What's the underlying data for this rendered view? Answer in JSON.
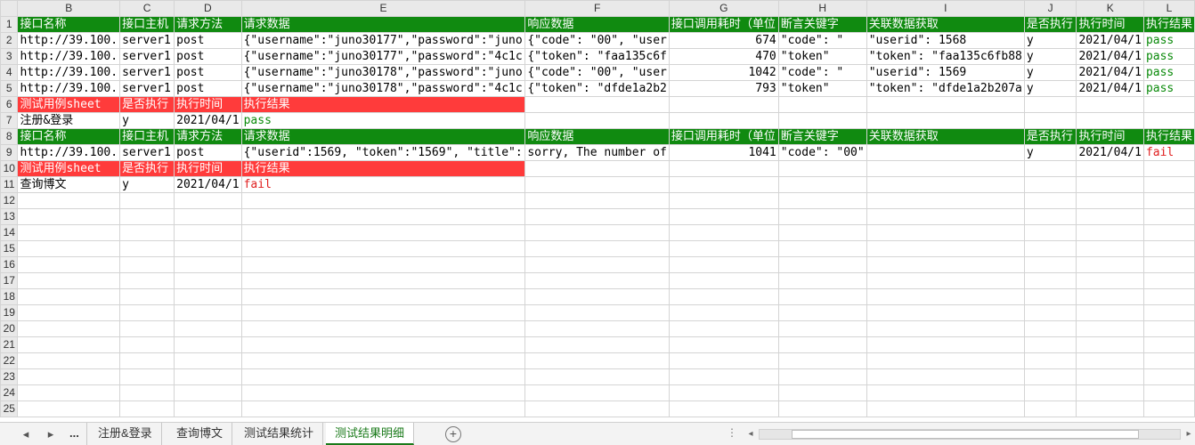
{
  "columns": [
    "B",
    "C",
    "D",
    "E",
    "F",
    "G",
    "H",
    "I",
    "J",
    "K",
    "L"
  ],
  "rows": [
    "1",
    "2",
    "3",
    "4",
    "5",
    "6",
    "7",
    "8",
    "9",
    "10",
    "11",
    "12",
    "13",
    "14",
    "15",
    "16",
    "17",
    "18",
    "19",
    "20",
    "21",
    "22",
    "23",
    "24",
    "25"
  ],
  "header1": [
    "接口名称",
    "接口主机",
    "请求方法",
    "请求数据",
    "响应数据",
    "接口调用耗时（单位",
    "断言关键字",
    "关联数据获取",
    "是否执行",
    "执行时间",
    "执行结果"
  ],
  "data1": [
    [
      "http://39.100.",
      "server1",
      "post",
      "{\"username\":\"juno30177\",\"password\":\"juno",
      "{\"code\": \"00\", \"user",
      "674",
      "\"code\": \"",
      "\"userid\": 1568",
      "y",
      "2021/04/1",
      "pass"
    ],
    [
      "http://39.100.",
      "server1",
      "post",
      "{\"username\":\"juno30177\",\"password\":\"4c1c",
      "{\"token\": \"faa135c6f",
      "470",
      "\"token\"",
      "\"token\": \"faa135c6fb88",
      "y",
      "2021/04/1",
      "pass"
    ],
    [
      "http://39.100.",
      "server1",
      "post",
      "{\"username\":\"juno30178\",\"password\":\"juno",
      "{\"code\": \"00\", \"user",
      "1042",
      "\"code\": \"",
      "\"userid\": 1569",
      "y",
      "2021/04/1",
      "pass"
    ],
    [
      "http://39.100.",
      "server1",
      "post",
      "{\"username\":\"juno30178\",\"password\":\"4c1c",
      "{\"token\": \"dfde1a2b2",
      "793",
      "\"token\"",
      "\"token\": \"dfde1a2b207a",
      "y",
      "2021/04/1",
      "pass"
    ]
  ],
  "summary_header": [
    "测试用例sheet",
    "是否执行",
    "执行时间",
    "执行结果"
  ],
  "summary1": [
    "注册&登录",
    "y",
    "2021/04/1",
    "pass"
  ],
  "header2": [
    "接口名称",
    "接口主机",
    "请求方法",
    "请求数据",
    "响应数据",
    "接口调用耗时（单位",
    "断言关键字",
    "关联数据获取",
    "是否执行",
    "执行时间",
    "执行结果"
  ],
  "data2": [
    [
      "http://39.100.",
      "server1",
      "post",
      "{\"userid\":1569, \"token\":\"1569\", \"title\":",
      "sorry, The number of",
      "1041",
      "\"code\": \"00\"",
      "",
      "y",
      "2021/04/1",
      "fail"
    ]
  ],
  "summary2": [
    "查询博文",
    "y",
    "2021/04/1",
    "fail"
  ],
  "tabs": {
    "more": "...",
    "items": [
      "注册&登录",
      "查询博文",
      "测试结果统计",
      "测试结果明细"
    ],
    "active": 3
  },
  "colors": {
    "header_green": "#108a10",
    "header_red": "#ff3b3b",
    "pass": "#0a8a0a",
    "fail": "#e02020",
    "active_tab": "#1a7a1a"
  }
}
